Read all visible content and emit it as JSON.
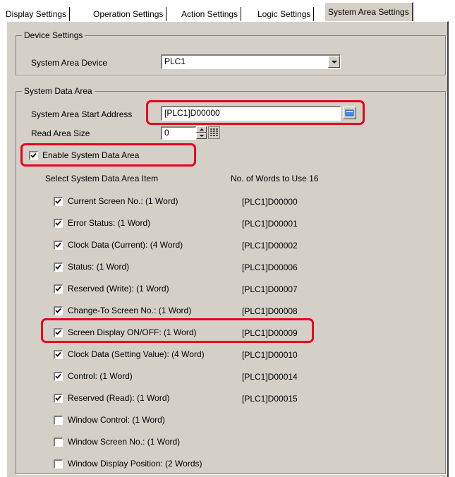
{
  "tabs": [
    "Display Settings",
    "Operation Settings",
    "Action Settings",
    "Logic Settings",
    "System Area Settings"
  ],
  "device_settings": {
    "title": "Device Settings",
    "device_label": "System Area Device",
    "device_value": "PLC1"
  },
  "system_data_area": {
    "title": "System Data Area",
    "start_address_label": "System Area Start Address",
    "start_address_value": "[PLC1]D00000",
    "read_size_label": "Read Area Size",
    "read_size_value": "0",
    "enable_label": "Enable System Data Area",
    "enable_checked": true,
    "col_item_header": "Select System Data Area Item",
    "col_words_header": "No. of Words to Use 16",
    "items": [
      {
        "label": "Current Screen No.: (1 Word)",
        "checked": true,
        "address": "[PLC1]D00000"
      },
      {
        "label": "Error Status: (1 Word)",
        "checked": true,
        "address": "[PLC1]D00001"
      },
      {
        "label": "Clock Data (Current): (4 Word)",
        "checked": true,
        "address": "[PLC1]D00002"
      },
      {
        "label": "Status: (1 Word)",
        "checked": true,
        "address": "[PLC1]D00006"
      },
      {
        "label": "Reserved (Write): (1 Word)",
        "checked": true,
        "address": "[PLC1]D00007"
      },
      {
        "label": "Change-To Screen No.: (1 Word)",
        "checked": true,
        "address": "[PLC1]D00008"
      },
      {
        "label": "Screen Display ON/OFF: (1 Word)",
        "checked": true,
        "address": "[PLC1]D00009"
      },
      {
        "label": "Clock Data (Setting Value): (4 Word)",
        "checked": true,
        "address": "[PLC1]D00010"
      },
      {
        "label": "Control: (1 Word)",
        "checked": true,
        "address": "[PLC1]D00014"
      },
      {
        "label": "Reserved (Read): (1 Word)",
        "checked": true,
        "address": "[PLC1]D00015"
      },
      {
        "label": "Window Control: (1 Word)",
        "checked": false,
        "address": ""
      },
      {
        "label": "Window Screen No.: (1 Word)",
        "checked": false,
        "address": ""
      },
      {
        "label": "Window Display Position: (2 Words)",
        "checked": false,
        "address": ""
      }
    ]
  },
  "colors": {
    "dialog_bg": "#d4d0c8",
    "highlight": "#e8001c"
  },
  "icons": {
    "address_input_button": "keypad-icon",
    "read_size_extra": "calculator-icon"
  }
}
